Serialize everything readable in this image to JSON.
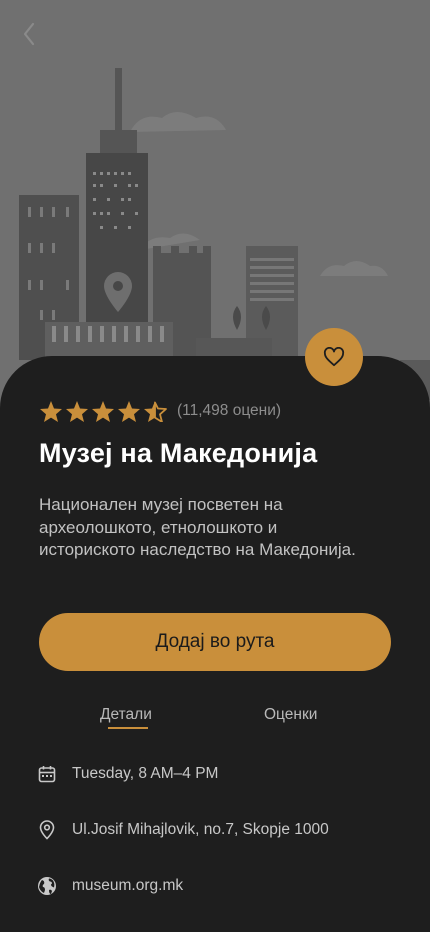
{
  "hero": {
    "back_icon": "chevron-left-icon",
    "colors": {
      "background": "#6f6f6f",
      "buildings": "#4c4c4c",
      "accent": "#c98f3b"
    }
  },
  "favorite": {
    "icon": "heart-icon"
  },
  "rating": {
    "stars": 4.5,
    "max": 5,
    "count_text": "(11,498 оцени)"
  },
  "title": "Музеј на Македонија",
  "description": "Национален музеј посветен на археолошкото, етнолошкото и историското наследство на Македонија.",
  "cta_label": "Додај во рута",
  "tabs": [
    {
      "label": "Детали",
      "active": true
    },
    {
      "label": "Оценки",
      "active": false
    }
  ],
  "info": {
    "hours": {
      "icon": "calendar-icon",
      "text": "Tuesday, 8 AM–4 PM"
    },
    "address": {
      "icon": "location-pin-icon",
      "text": "Ul.Josif Mihajlovik, no.7, Skopje 1000"
    },
    "website": {
      "icon": "globe-icon",
      "text": "museum.org.mk"
    }
  }
}
